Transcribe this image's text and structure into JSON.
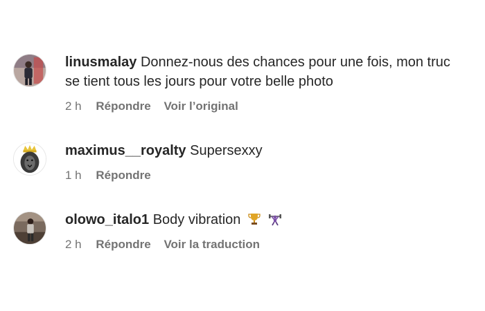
{
  "comments": [
    {
      "username": "linusmalay",
      "text": "Donnez-nous des chances pour une fois, mon truc se tient tous les jours pour votre belle photo",
      "time": "2 h",
      "reply_label": "Répondre",
      "extra_label": "Voir l’original"
    },
    {
      "username": "maximus__royalty",
      "text": "Supersexxy",
      "time": "1 h",
      "reply_label": "Répondre"
    },
    {
      "username": "olowo_italo1",
      "text": "Body vibration",
      "emojis": [
        "trophy-icon",
        "weightlifter-icon"
      ],
      "time": "2 h",
      "reply_label": "Répondre",
      "extra_label": "Voir la traduction"
    }
  ],
  "colors": {
    "text": "#262626",
    "secondary": "#737373"
  }
}
